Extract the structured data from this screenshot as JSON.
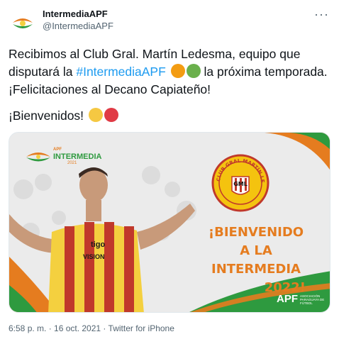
{
  "user": {
    "name": "IntermediaAPF",
    "handle": "@IntermediaAPF"
  },
  "tweet": {
    "text_part1": "Recibimos al Club Gral. Martín Ledesma, equipo que disputará la ",
    "hashtag": "#IntermediaAPF",
    "text_part2": " la próxima temporada. ¡Felicitaciones al Decano Capiateño!",
    "welcome": "¡Bienvenidos!",
    "emoji_dots_1": [
      "#f39c12",
      "#6ab04c"
    ],
    "emoji_dots_2": [
      "#f5c842",
      "#e03a45"
    ]
  },
  "card": {
    "logo_small_top": "APF",
    "logo_small_main": "INTERMEDIA",
    "logo_small_year": "2021",
    "crest_arc": "CLUB GRAL MARTÍN LEDESMA",
    "crest_monogram": "GML",
    "headline_line1": "¡BIENVENIDO",
    "headline_line2": "A LA INTERMEDIA",
    "headline_line3": "2022!",
    "jersey_sponsor1": "tigo",
    "jersey_sponsor2": "VISION",
    "apf_logo": "APF",
    "apf_sub": "ASOCIACIÓN PARAGUAYA DE FÚTBOL",
    "colors": {
      "orange": "#e57c1f",
      "green": "#2e9a3f",
      "yellow": "#f4d03f",
      "red": "#c0392b"
    }
  },
  "meta": {
    "timestamp": "6:58 p. m. · 16 oct. 2021 · Twitter for iPhone"
  }
}
